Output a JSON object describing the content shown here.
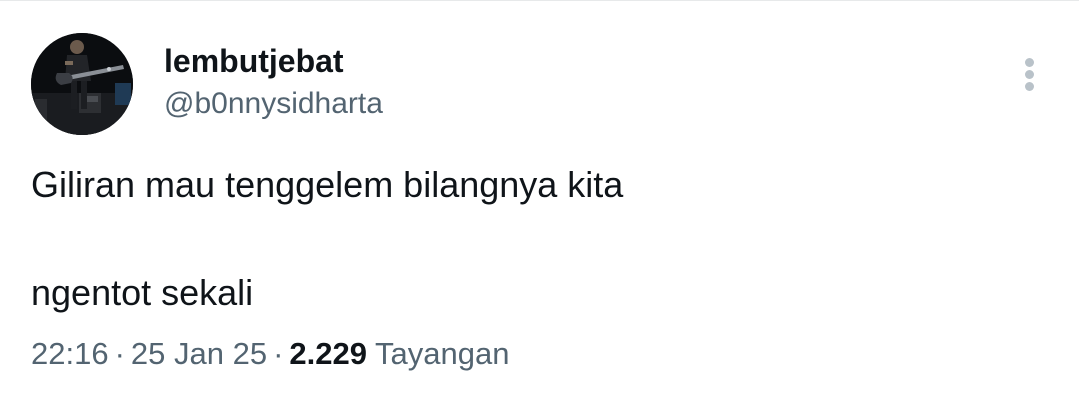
{
  "tweet": {
    "author": {
      "display_name": "lembutjebat",
      "handle": "@b0nnysidharta",
      "avatar_icon": "avatar-guitarist-photo"
    },
    "text_lines": [
      "Giliran mau tenggelem bilangnya kita",
      "ngentot sekali"
    ],
    "meta": {
      "time": "22:16",
      "separator": "·",
      "date": "25 Jan 25",
      "views_count": "2.229",
      "views_label": "Tayangan"
    },
    "more_icon": "more-vertical-icon"
  },
  "colors": {
    "text_primary": "#0f1419",
    "text_secondary": "#536471",
    "divider": "#e7e9ea",
    "more_dots": "#b9c2c9"
  }
}
